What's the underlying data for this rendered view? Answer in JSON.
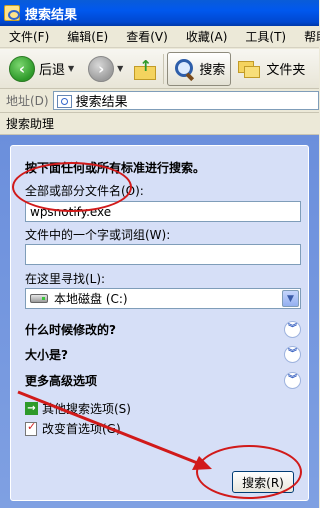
{
  "window": {
    "title": "搜索结果"
  },
  "menubar": {
    "items": [
      "文件(F)",
      "编辑(E)",
      "查看(V)",
      "收藏(A)",
      "工具(T)",
      "帮助"
    ]
  },
  "toolbar": {
    "back_label": "后退",
    "search_label": "搜索",
    "folders_label": "文件夹"
  },
  "address": {
    "label": "地址(D)",
    "value": "搜索结果"
  },
  "pane": {
    "title": "搜索助理",
    "heading": "按下面任何或所有标准进行搜索。",
    "filename_label": "全部或部分文件名(O):",
    "filename_value": "wpsnotify.exe",
    "phrase_label": "文件中的一个字或词组(W):",
    "phrase_value": "",
    "lookin_label": "在这里寻找(L):",
    "lookin_value": "本地磁盘 (C:)",
    "expanders": [
      "什么时候修改的?",
      "大小是?",
      "更多高级选项"
    ],
    "links": [
      "其他搜索选项(S)",
      "改变首选项(G)"
    ],
    "search_button": "搜索(R)"
  },
  "annotations": {
    "color": "#D11A1A"
  }
}
